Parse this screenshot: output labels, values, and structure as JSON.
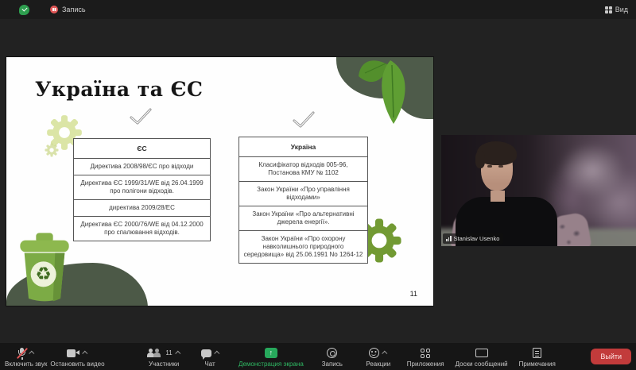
{
  "topbar": {
    "recording_indicator_label": "Запись",
    "view_button_label": "Вид"
  },
  "slide": {
    "title": "Україна та ЄС",
    "page_number": "11",
    "tables": [
      {
        "header": "ЄС",
        "rows": [
          "Директива 2008/98/ЄС про відходи",
          "Директива ЄС 1999/31/WE від 26.04.1999 про полігони відходів.",
          "директива 2009/28/ЕС",
          "Директива ЄС 2000/76/WE від 04.12.2000 про спалювання відходів."
        ]
      },
      {
        "header": "Україна",
        "rows": [
          "Класифікатор відходів 005-96, Постанова КМУ № 1102",
          "Закон України «Про управління відходами»",
          "Закон України «Про альтернативні джерела енергії».",
          "Закон України «Про охорону навколишнього природного середовища» від 25.06.1991 No 1264-12"
        ]
      }
    ]
  },
  "video": {
    "participant_name": "Stanislav Usenko"
  },
  "toolbar": {
    "mute_label": "Включить звук",
    "stop_video_label": "Остановить видео",
    "participants_label": "Участники",
    "participants_count": "11",
    "chat_label": "Чат",
    "share_label": "Демонстрация экрана",
    "record_label": "Запись",
    "reactions_label": "Реакции",
    "apps_label": "Приложения",
    "whiteboard_label": "Доски сообщений",
    "notes_label": "Примечания",
    "leave_label": "Выйти"
  },
  "colors": {
    "share_green": "#27a95c",
    "leave_red": "#c23b3b",
    "record_red": "#e05656",
    "shield_green": "#2e9e4f",
    "leaf_green": "#5f9e33",
    "sage_green": "#4e5b4a",
    "gear_light": "#dbe5a6",
    "gear_dark": "#729a33",
    "bin_green": "#7cab45"
  }
}
